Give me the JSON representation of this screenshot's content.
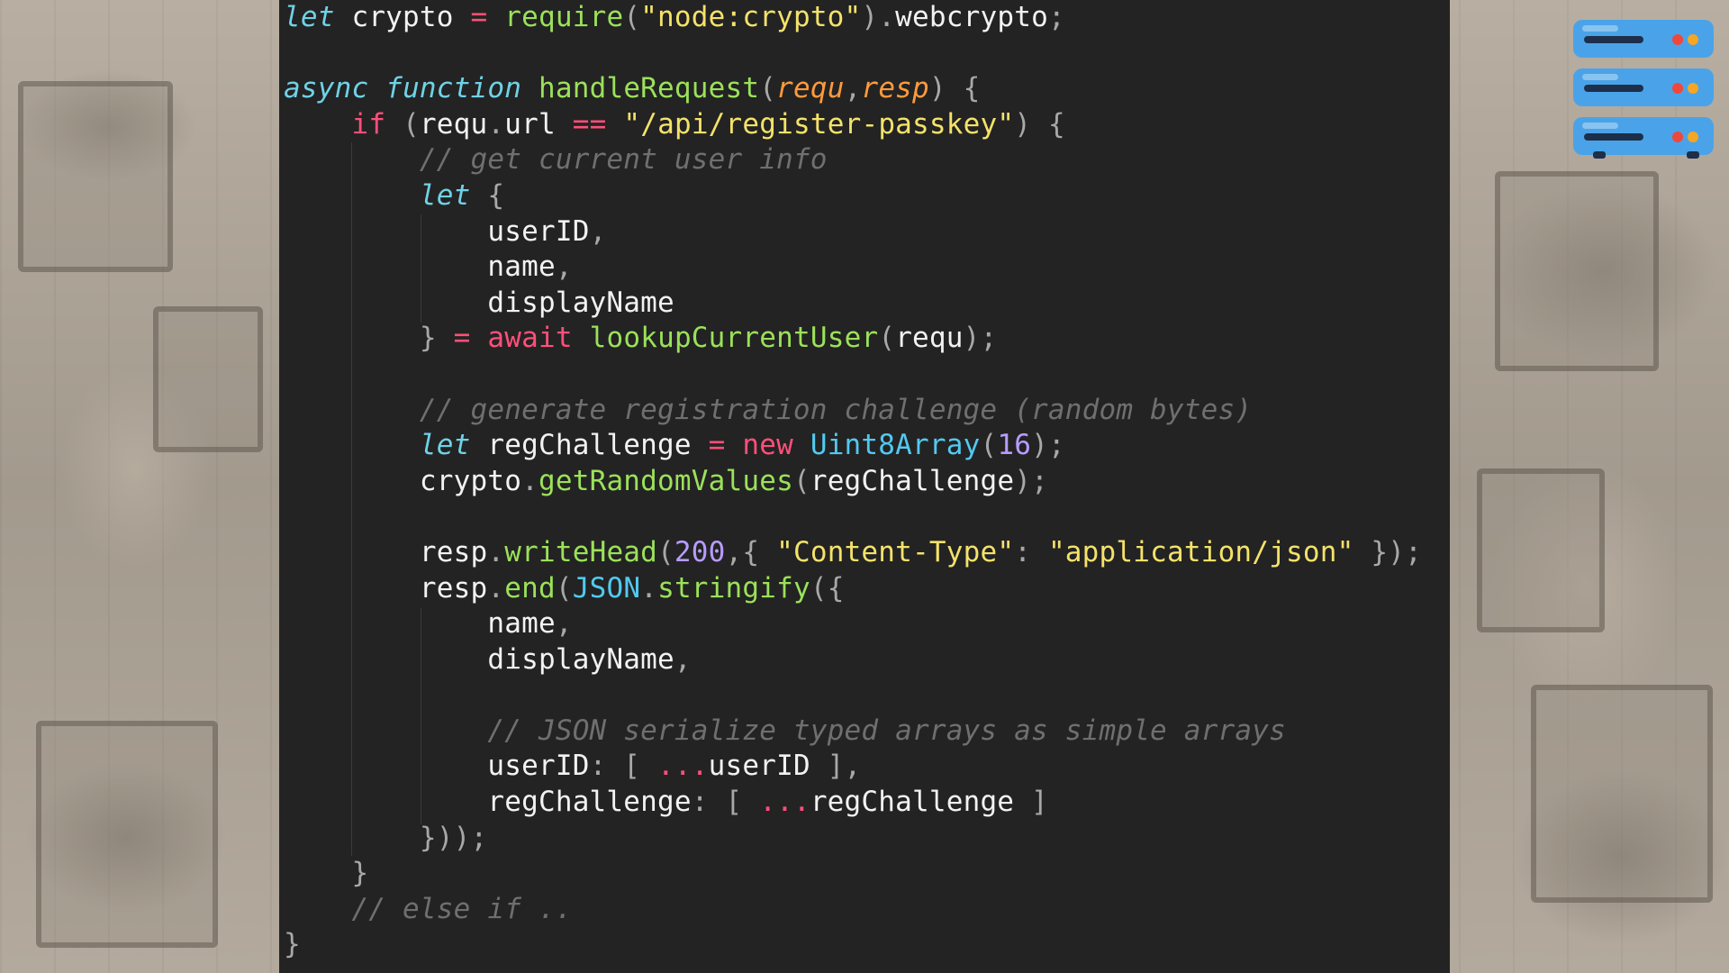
{
  "code": {
    "language": "javascript",
    "lines": [
      [
        {
          "t": "let",
          "c": "kw-it"
        },
        {
          "t": " crypto ",
          "c": "txt"
        },
        {
          "t": "=",
          "c": "kw-red"
        },
        {
          "t": " ",
          "c": "txt"
        },
        {
          "t": "require",
          "c": "fn"
        },
        {
          "t": "(",
          "c": "punc"
        },
        {
          "t": "\"node:crypto\"",
          "c": "str"
        },
        {
          "t": ").",
          "c": "punc"
        },
        {
          "t": "webcrypto",
          "c": "txt"
        },
        {
          "t": ";",
          "c": "punc"
        }
      ],
      [],
      [
        {
          "t": "async",
          "c": "kw-it"
        },
        {
          "t": " ",
          "c": "txt"
        },
        {
          "t": "function",
          "c": "kw-it"
        },
        {
          "t": " ",
          "c": "txt"
        },
        {
          "t": "handleRequest",
          "c": "fn"
        },
        {
          "t": "(",
          "c": "punc"
        },
        {
          "t": "requ",
          "c": "param"
        },
        {
          "t": ",",
          "c": "punc"
        },
        {
          "t": "resp",
          "c": "param"
        },
        {
          "t": ") {",
          "c": "punc"
        }
      ],
      [
        {
          "t": "    ",
          "c": "txt"
        },
        {
          "t": "if",
          "c": "kw-red"
        },
        {
          "t": " (",
          "c": "punc"
        },
        {
          "t": "requ",
          "c": "txt"
        },
        {
          "t": ".",
          "c": "punc"
        },
        {
          "t": "url ",
          "c": "txt"
        },
        {
          "t": "==",
          "c": "kw-red"
        },
        {
          "t": " ",
          "c": "txt"
        },
        {
          "t": "\"/api/register-passkey\"",
          "c": "str"
        },
        {
          "t": ") {",
          "c": "punc"
        }
      ],
      [
        {
          "t": "        ",
          "c": "txt"
        },
        {
          "t": "// get current user info",
          "c": "cmt"
        }
      ],
      [
        {
          "t": "        ",
          "c": "txt"
        },
        {
          "t": "let",
          "c": "kw-it"
        },
        {
          "t": " {",
          "c": "punc"
        }
      ],
      [
        {
          "t": "            ",
          "c": "txt"
        },
        {
          "t": "userID",
          "c": "txt"
        },
        {
          "t": ",",
          "c": "punc"
        }
      ],
      [
        {
          "t": "            ",
          "c": "txt"
        },
        {
          "t": "name",
          "c": "txt"
        },
        {
          "t": ",",
          "c": "punc"
        }
      ],
      [
        {
          "t": "            ",
          "c": "txt"
        },
        {
          "t": "displayName",
          "c": "txt"
        }
      ],
      [
        {
          "t": "        ",
          "c": "txt"
        },
        {
          "t": "}",
          "c": "punc"
        },
        {
          "t": " ",
          "c": "txt"
        },
        {
          "t": "=",
          "c": "kw-red"
        },
        {
          "t": " ",
          "c": "txt"
        },
        {
          "t": "await",
          "c": "kw-red"
        },
        {
          "t": " ",
          "c": "txt"
        },
        {
          "t": "lookupCurrentUser",
          "c": "fn"
        },
        {
          "t": "(",
          "c": "punc"
        },
        {
          "t": "requ",
          "c": "txt"
        },
        {
          "t": ");",
          "c": "punc"
        }
      ],
      [],
      [
        {
          "t": "        ",
          "c": "txt"
        },
        {
          "t": "// generate registration challenge (random bytes)",
          "c": "cmt"
        }
      ],
      [
        {
          "t": "        ",
          "c": "txt"
        },
        {
          "t": "let",
          "c": "kw-it"
        },
        {
          "t": " regChallenge ",
          "c": "txt"
        },
        {
          "t": "=",
          "c": "kw-red"
        },
        {
          "t": " ",
          "c": "txt"
        },
        {
          "t": "new",
          "c": "kw-red"
        },
        {
          "t": " ",
          "c": "txt"
        },
        {
          "t": "Uint8Array",
          "c": "cls"
        },
        {
          "t": "(",
          "c": "punc"
        },
        {
          "t": "16",
          "c": "num"
        },
        {
          "t": ");",
          "c": "punc"
        }
      ],
      [
        {
          "t": "        ",
          "c": "txt"
        },
        {
          "t": "crypto",
          "c": "txt"
        },
        {
          "t": ".",
          "c": "punc"
        },
        {
          "t": "getRandomValues",
          "c": "fn"
        },
        {
          "t": "(",
          "c": "punc"
        },
        {
          "t": "regChallenge",
          "c": "txt"
        },
        {
          "t": ");",
          "c": "punc"
        }
      ],
      [],
      [
        {
          "t": "        ",
          "c": "txt"
        },
        {
          "t": "resp",
          "c": "txt"
        },
        {
          "t": ".",
          "c": "punc"
        },
        {
          "t": "writeHead",
          "c": "fn"
        },
        {
          "t": "(",
          "c": "punc"
        },
        {
          "t": "200",
          "c": "num"
        },
        {
          "t": ",{ ",
          "c": "punc"
        },
        {
          "t": "\"Content-Type\"",
          "c": "str"
        },
        {
          "t": ": ",
          "c": "punc"
        },
        {
          "t": "\"application/json\"",
          "c": "str"
        },
        {
          "t": " });",
          "c": "punc"
        }
      ],
      [
        {
          "t": "        ",
          "c": "txt"
        },
        {
          "t": "resp",
          "c": "txt"
        },
        {
          "t": ".",
          "c": "punc"
        },
        {
          "t": "end",
          "c": "fn"
        },
        {
          "t": "(",
          "c": "punc"
        },
        {
          "t": "JSON",
          "c": "cls"
        },
        {
          "t": ".",
          "c": "punc"
        },
        {
          "t": "stringify",
          "c": "fn"
        },
        {
          "t": "({",
          "c": "punc"
        }
      ],
      [
        {
          "t": "            ",
          "c": "txt"
        },
        {
          "t": "name",
          "c": "txt"
        },
        {
          "t": ",",
          "c": "punc"
        }
      ],
      [
        {
          "t": "            ",
          "c": "txt"
        },
        {
          "t": "displayName",
          "c": "txt"
        },
        {
          "t": ",",
          "c": "punc"
        }
      ],
      [],
      [
        {
          "t": "            ",
          "c": "txt"
        },
        {
          "t": "// JSON serialize typed arrays as simple arrays",
          "c": "cmt"
        }
      ],
      [
        {
          "t": "            ",
          "c": "txt"
        },
        {
          "t": "userID",
          "c": "txt"
        },
        {
          "t": ": [ ",
          "c": "punc"
        },
        {
          "t": "...",
          "c": "kw-red"
        },
        {
          "t": "userID",
          "c": "txt"
        },
        {
          "t": " ],",
          "c": "punc"
        }
      ],
      [
        {
          "t": "            ",
          "c": "txt"
        },
        {
          "t": "regChallenge",
          "c": "txt"
        },
        {
          "t": ": [ ",
          "c": "punc"
        },
        {
          "t": "...",
          "c": "kw-red"
        },
        {
          "t": "regChallenge",
          "c": "txt"
        },
        {
          "t": " ]",
          "c": "punc"
        }
      ],
      [
        {
          "t": "        ",
          "c": "txt"
        },
        {
          "t": "}));",
          "c": "punc"
        }
      ],
      [
        {
          "t": "    ",
          "c": "txt"
        },
        {
          "t": "}",
          "c": "punc"
        }
      ],
      [
        {
          "t": "    ",
          "c": "txt"
        },
        {
          "t": "// else if ..",
          "c": "cmt"
        }
      ],
      [
        {
          "t": "}",
          "c": "punc"
        }
      ]
    ]
  },
  "icon": {
    "name": "server-rack-icon",
    "units": 3,
    "unit_color": "#4aa3e8",
    "led_colors": [
      "#f0473c",
      "#f5a623"
    ]
  }
}
